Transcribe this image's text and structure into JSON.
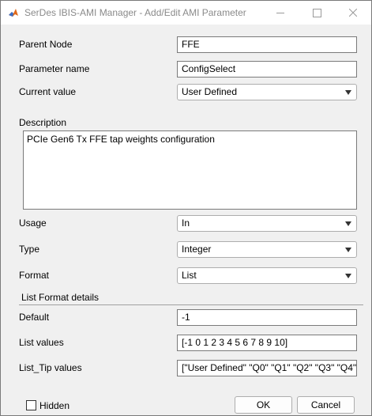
{
  "window": {
    "title": "SerDes IBIS-AMI Manager - Add/Edit AMI Parameter",
    "icon": "matlab-icon"
  },
  "form": {
    "parent_node_label": "Parent Node",
    "parent_node_value": "FFE",
    "parameter_name_label": "Parameter name",
    "parameter_name_value": "ConfigSelect",
    "current_value_label": "Current value",
    "current_value_selected": "User Defined",
    "description_label": "Description",
    "description_value": "PCIe Gen6 Tx FFE tap weights configuration",
    "usage_label": "Usage",
    "usage_selected": "In",
    "type_label": "Type",
    "type_selected": "Integer",
    "format_label": "Format",
    "format_selected": "List"
  },
  "list_format": {
    "section_title": "List Format details",
    "default_label": "Default",
    "default_value": "-1",
    "list_values_label": "List values",
    "list_values_value": "[-1 0 1 2 3 4 5 6 7 8 9 10]",
    "list_tip_label": "List_Tip values",
    "list_tip_value": "[\"User Defined\" \"Q0\" \"Q1\" \"Q2\" \"Q3\" \"Q4\""
  },
  "footer": {
    "hidden_label": "Hidden",
    "hidden_checked": false,
    "ok_label": "OK",
    "cancel_label": "Cancel"
  }
}
